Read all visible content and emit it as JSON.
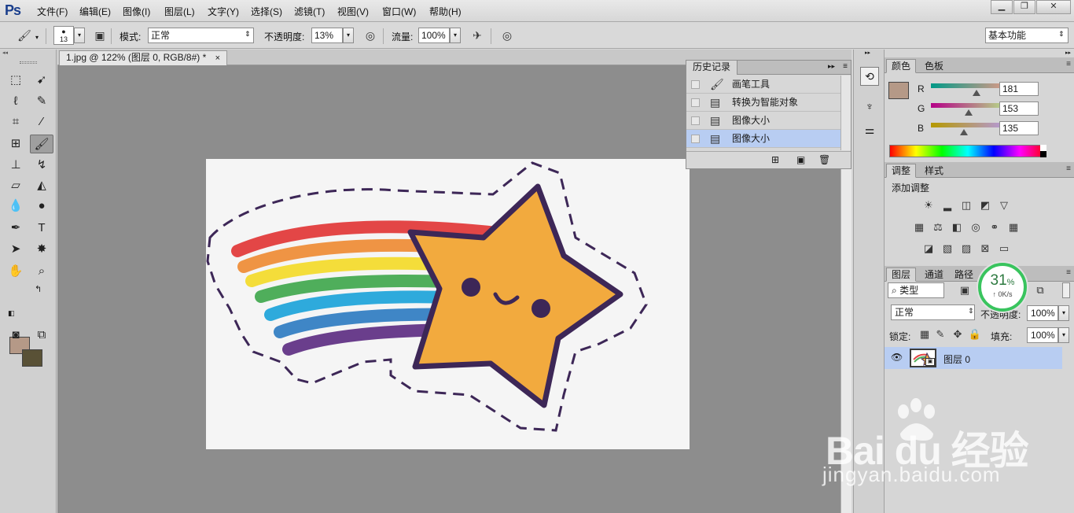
{
  "app": {
    "logo": "Ps",
    "menu": [
      "文件(F)",
      "编辑(E)",
      "图像(I)",
      "图层(L)",
      "文字(Y)",
      "选择(S)",
      "滤镜(T)",
      "视图(V)",
      "窗口(W)",
      "帮助(H)"
    ]
  },
  "options": {
    "brush_size": "13",
    "mode_label": "模式:",
    "mode_value": "正常",
    "opacity_label": "不透明度:",
    "opacity_value": "13%",
    "flow_label": "流量:",
    "flow_value": "100%",
    "workspace": "基本功能"
  },
  "document": {
    "tab_title": "1.jpg @ 122% (图层 0, RGB/8#) *",
    "tab_close": "×"
  },
  "history": {
    "title": "历史记录",
    "items": [
      {
        "label": "画笔工具",
        "icon": "brush-icon",
        "selected": false
      },
      {
        "label": "转换为智能对象",
        "icon": "document-icon",
        "selected": false
      },
      {
        "label": "图像大小",
        "icon": "document-icon",
        "selected": false
      },
      {
        "label": "图像大小",
        "icon": "document-icon",
        "selected": true
      }
    ]
  },
  "color_panel": {
    "tabs": [
      "颜色",
      "色板"
    ],
    "r_label": "R",
    "g_label": "G",
    "b_label": "B",
    "r": "181",
    "g": "153",
    "b": "135",
    "foreground": "#b59987",
    "background": "#595136"
  },
  "adjustments_panel": {
    "tabs": [
      "调整",
      "样式"
    ],
    "heading": "添加调整"
  },
  "layers_panel": {
    "tabs": [
      "图层",
      "通道",
      "路径"
    ],
    "filter": "类型",
    "blend_mode": "正常",
    "opacity_label": "不透明度:",
    "opacity": "100%",
    "lock_label": "锁定:",
    "fill_label": "填充:",
    "fill": "100%",
    "layer_name": "图层 0"
  },
  "meter": {
    "value": "31",
    "unit": "%",
    "speed": "↑ 0K/s"
  },
  "watermark": {
    "logo": "Bai du 经验",
    "url": "jingyan.baidu.com"
  },
  "colors": {
    "accent_selection": "#b8cdf2",
    "canvas_bg": "#8d8d8d",
    "star_fill": "#f2aa3e",
    "star_outline": "#3d2757",
    "rainbow": [
      "#e34646",
      "#ef9444",
      "#f4dd3a",
      "#4fae5b",
      "#2eaadc",
      "#3f86c6",
      "#6a3e8c"
    ]
  }
}
